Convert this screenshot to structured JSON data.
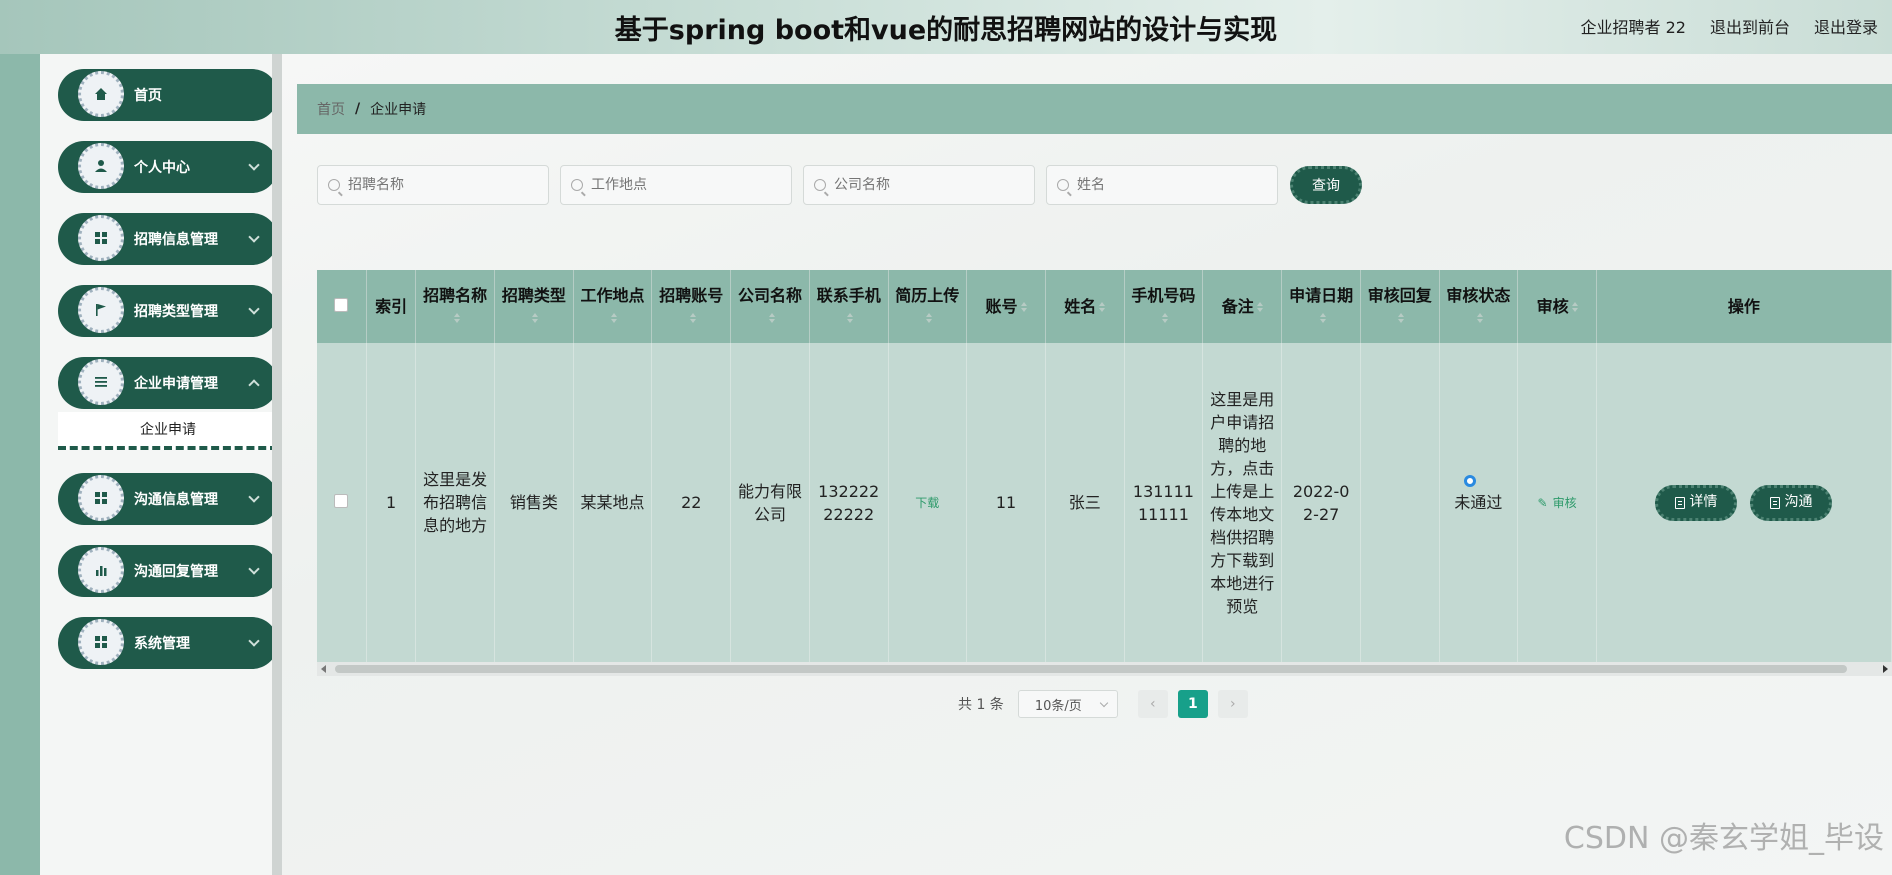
{
  "header": {
    "title": "基于spring boot和vue的耐思招聘网站的设计与实现",
    "user": "企业招聘者 22",
    "back_to_front": "退出到前台",
    "logout": "退出登录"
  },
  "sidebar": {
    "items": [
      {
        "label": "首页",
        "icon": "home-icon",
        "has_children": false
      },
      {
        "label": "个人中心",
        "icon": "user-icon",
        "has_children": true
      },
      {
        "label": "招聘信息管理",
        "icon": "grid-icon",
        "has_children": true
      },
      {
        "label": "招聘类型管理",
        "icon": "flag-icon",
        "has_children": true
      },
      {
        "label": "企业申请管理",
        "icon": "list-icon",
        "has_children": true,
        "expanded": true
      },
      {
        "label": "沟通信息管理",
        "icon": "grid-icon",
        "has_children": true
      },
      {
        "label": "沟通回复管理",
        "icon": "chart-icon",
        "has_children": true
      },
      {
        "label": "系统管理",
        "icon": "grid-icon",
        "has_children": true
      }
    ],
    "submenu": {
      "label": "企业申请"
    }
  },
  "breadcrumb": {
    "home": "首页",
    "separator": "/",
    "current": "企业申请"
  },
  "search": {
    "job_name_placeholder": "招聘名称",
    "location_placeholder": "工作地点",
    "company_placeholder": "公司名称",
    "name_placeholder": "姓名",
    "button": "查询"
  },
  "table": {
    "headers": [
      "索引",
      "招聘名称",
      "招聘类型",
      "工作地点",
      "招聘账号",
      "公司名称",
      "联系手机",
      "简历上传",
      "账号",
      "姓名",
      "手机号码",
      "备注",
      "申请日期",
      "审核回复",
      "审核状态",
      "审核",
      "操作"
    ],
    "rows": [
      {
        "index": "1",
        "job_name": "这里是发布招聘信息的地方",
        "job_type": "销售类",
        "location": "某某地点",
        "recruiter_account": "22",
        "company": "能力有限公司",
        "contact_phone": "13222222222",
        "resume": "下载",
        "account": "11",
        "name": "张三",
        "phone": "13111111111",
        "remark": "这里是用户申请招聘的地方，点击上传是上传本地文档供招聘方下载到本地进行预览",
        "apply_date": "2022-02-27",
        "review_reply": "",
        "review_status": "未通过",
        "review_action": "审核",
        "detail_btn": "详情",
        "chat_btn": "沟通"
      }
    ]
  },
  "pagination": {
    "total": "共 1 条",
    "page_size": "10条/页",
    "prev": "‹",
    "next": "›",
    "current": "1"
  },
  "watermark": "CSDN @秦玄学姐_毕设"
}
